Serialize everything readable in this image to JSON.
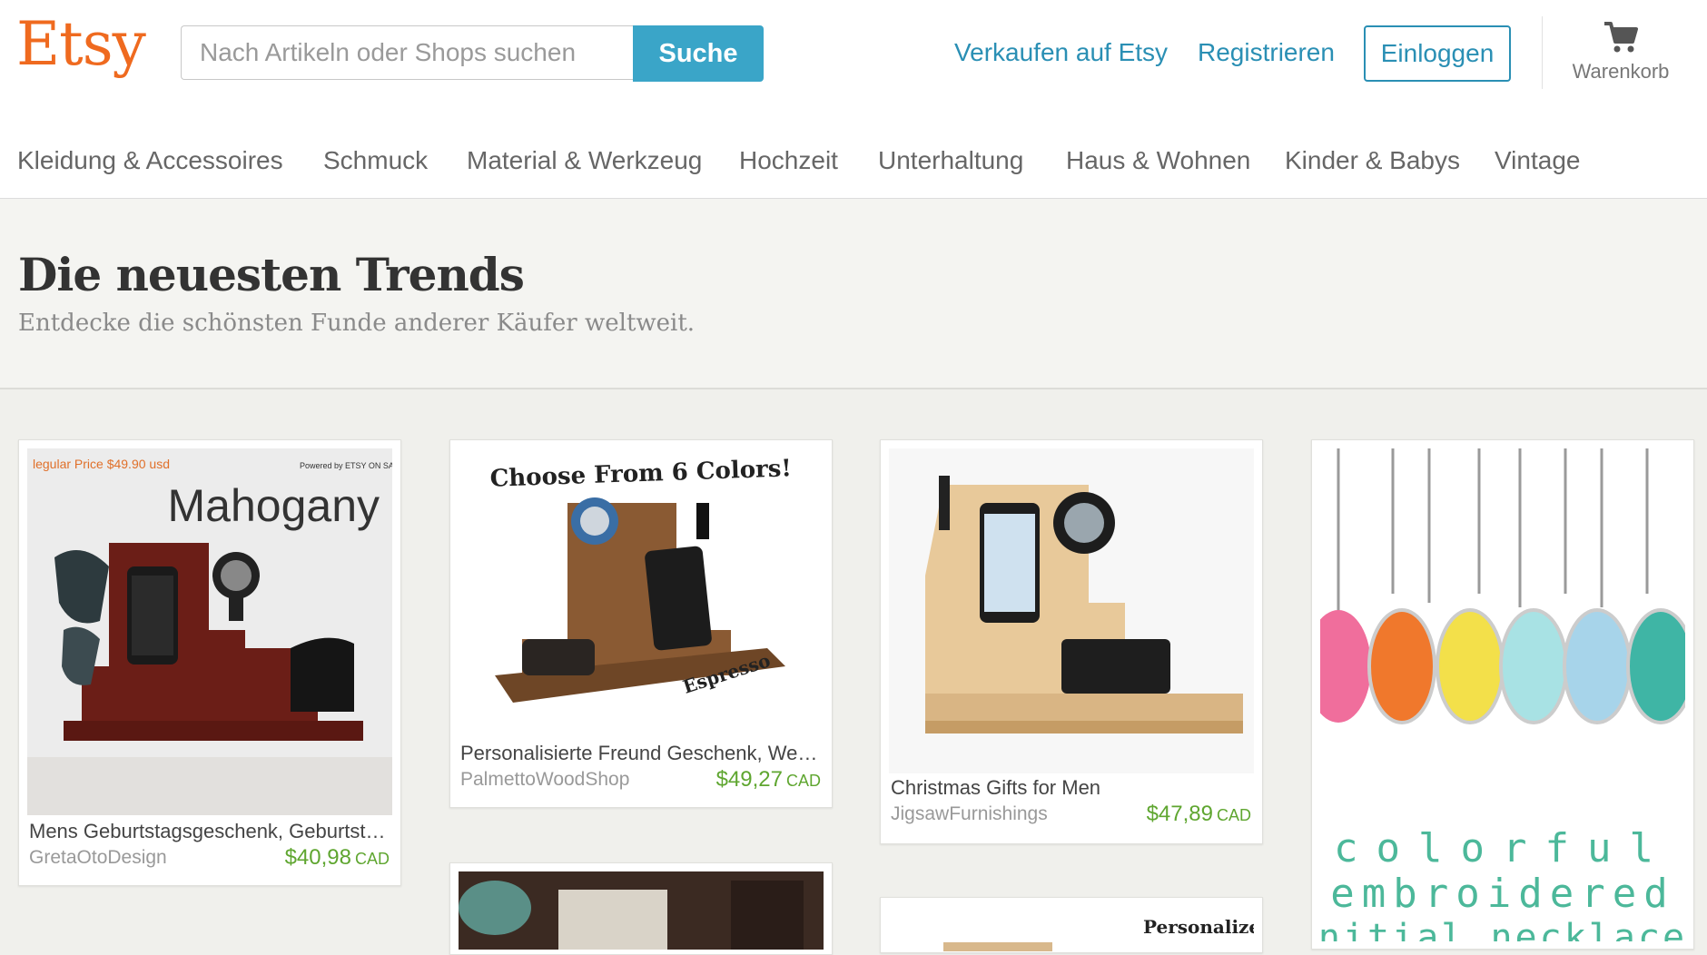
{
  "header": {
    "logo": "Etsy",
    "search_placeholder": "Nach Artikeln oder Shops suchen",
    "search_button": "Suche",
    "sell_link": "Verkaufen auf Etsy",
    "register_link": "Registrieren",
    "login_button": "Einloggen",
    "cart_label": "Warenkorb",
    "cart_icon": "shopping-cart-icon"
  },
  "categories": [
    "Kleidung & Accessoires",
    "Schmuck",
    "Material & Werkzeug",
    "Hochzeit",
    "Unterhaltung",
    "Haus & Wohnen",
    "Kinder & Babys",
    "Vintage"
  ],
  "hero": {
    "title": "Die neuesten Trends",
    "subtitle": "Entdecke die schönsten Funde anderer Käufer weltweit."
  },
  "listings": [
    {
      "title": "Mens Geburtstagsgeschenk, Geburtstagsgeschenk",
      "shop": "GretaOtoDesign",
      "price": "$40,98",
      "currency": "CAD",
      "image_text": {
        "regular_price": "legular Price $49.90 usd",
        "powered": "Powered by ETSY ON SALE",
        "headline": "Mahogany"
      }
    },
    {
      "title": "Personalisierte Freund Geschenk, Weihnachtsgeschenk",
      "shop": "PalmettoWoodShop",
      "price": "$49,27",
      "currency": "CAD",
      "image_text": {
        "headline": "Choose From 6 Colors!",
        "label": "Espresso"
      }
    },
    {
      "title": "Christmas Gifts for Men",
      "shop": "JigsawFurnishings",
      "price": "$47,89",
      "currency": "CAD"
    }
  ],
  "partial_cards": {
    "necklace_text": [
      "colorful",
      "embroidered",
      "initial necklaces"
    ],
    "personalized_text": "Personalized"
  }
}
